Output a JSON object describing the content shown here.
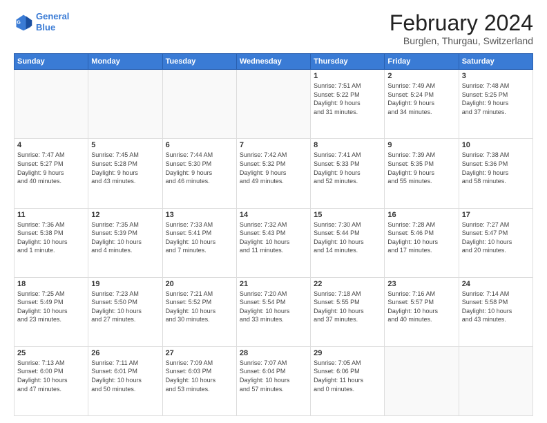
{
  "logo": {
    "line1": "General",
    "line2": "Blue"
  },
  "title": "February 2024",
  "subtitle": "Burglen, Thurgau, Switzerland",
  "days_of_week": [
    "Sunday",
    "Monday",
    "Tuesday",
    "Wednesday",
    "Thursday",
    "Friday",
    "Saturday"
  ],
  "weeks": [
    [
      {
        "day": "",
        "info": ""
      },
      {
        "day": "",
        "info": ""
      },
      {
        "day": "",
        "info": ""
      },
      {
        "day": "",
        "info": ""
      },
      {
        "day": "1",
        "info": "Sunrise: 7:51 AM\nSunset: 5:22 PM\nDaylight: 9 hours\nand 31 minutes."
      },
      {
        "day": "2",
        "info": "Sunrise: 7:49 AM\nSunset: 5:24 PM\nDaylight: 9 hours\nand 34 minutes."
      },
      {
        "day": "3",
        "info": "Sunrise: 7:48 AM\nSunset: 5:25 PM\nDaylight: 9 hours\nand 37 minutes."
      }
    ],
    [
      {
        "day": "4",
        "info": "Sunrise: 7:47 AM\nSunset: 5:27 PM\nDaylight: 9 hours\nand 40 minutes."
      },
      {
        "day": "5",
        "info": "Sunrise: 7:45 AM\nSunset: 5:28 PM\nDaylight: 9 hours\nand 43 minutes."
      },
      {
        "day": "6",
        "info": "Sunrise: 7:44 AM\nSunset: 5:30 PM\nDaylight: 9 hours\nand 46 minutes."
      },
      {
        "day": "7",
        "info": "Sunrise: 7:42 AM\nSunset: 5:32 PM\nDaylight: 9 hours\nand 49 minutes."
      },
      {
        "day": "8",
        "info": "Sunrise: 7:41 AM\nSunset: 5:33 PM\nDaylight: 9 hours\nand 52 minutes."
      },
      {
        "day": "9",
        "info": "Sunrise: 7:39 AM\nSunset: 5:35 PM\nDaylight: 9 hours\nand 55 minutes."
      },
      {
        "day": "10",
        "info": "Sunrise: 7:38 AM\nSunset: 5:36 PM\nDaylight: 9 hours\nand 58 minutes."
      }
    ],
    [
      {
        "day": "11",
        "info": "Sunrise: 7:36 AM\nSunset: 5:38 PM\nDaylight: 10 hours\nand 1 minute."
      },
      {
        "day": "12",
        "info": "Sunrise: 7:35 AM\nSunset: 5:39 PM\nDaylight: 10 hours\nand 4 minutes."
      },
      {
        "day": "13",
        "info": "Sunrise: 7:33 AM\nSunset: 5:41 PM\nDaylight: 10 hours\nand 7 minutes."
      },
      {
        "day": "14",
        "info": "Sunrise: 7:32 AM\nSunset: 5:43 PM\nDaylight: 10 hours\nand 11 minutes."
      },
      {
        "day": "15",
        "info": "Sunrise: 7:30 AM\nSunset: 5:44 PM\nDaylight: 10 hours\nand 14 minutes."
      },
      {
        "day": "16",
        "info": "Sunrise: 7:28 AM\nSunset: 5:46 PM\nDaylight: 10 hours\nand 17 minutes."
      },
      {
        "day": "17",
        "info": "Sunrise: 7:27 AM\nSunset: 5:47 PM\nDaylight: 10 hours\nand 20 minutes."
      }
    ],
    [
      {
        "day": "18",
        "info": "Sunrise: 7:25 AM\nSunset: 5:49 PM\nDaylight: 10 hours\nand 23 minutes."
      },
      {
        "day": "19",
        "info": "Sunrise: 7:23 AM\nSunset: 5:50 PM\nDaylight: 10 hours\nand 27 minutes."
      },
      {
        "day": "20",
        "info": "Sunrise: 7:21 AM\nSunset: 5:52 PM\nDaylight: 10 hours\nand 30 minutes."
      },
      {
        "day": "21",
        "info": "Sunrise: 7:20 AM\nSunset: 5:54 PM\nDaylight: 10 hours\nand 33 minutes."
      },
      {
        "day": "22",
        "info": "Sunrise: 7:18 AM\nSunset: 5:55 PM\nDaylight: 10 hours\nand 37 minutes."
      },
      {
        "day": "23",
        "info": "Sunrise: 7:16 AM\nSunset: 5:57 PM\nDaylight: 10 hours\nand 40 minutes."
      },
      {
        "day": "24",
        "info": "Sunrise: 7:14 AM\nSunset: 5:58 PM\nDaylight: 10 hours\nand 43 minutes."
      }
    ],
    [
      {
        "day": "25",
        "info": "Sunrise: 7:13 AM\nSunset: 6:00 PM\nDaylight: 10 hours\nand 47 minutes."
      },
      {
        "day": "26",
        "info": "Sunrise: 7:11 AM\nSunset: 6:01 PM\nDaylight: 10 hours\nand 50 minutes."
      },
      {
        "day": "27",
        "info": "Sunrise: 7:09 AM\nSunset: 6:03 PM\nDaylight: 10 hours\nand 53 minutes."
      },
      {
        "day": "28",
        "info": "Sunrise: 7:07 AM\nSunset: 6:04 PM\nDaylight: 10 hours\nand 57 minutes."
      },
      {
        "day": "29",
        "info": "Sunrise: 7:05 AM\nSunset: 6:06 PM\nDaylight: 11 hours\nand 0 minutes."
      },
      {
        "day": "",
        "info": ""
      },
      {
        "day": "",
        "info": ""
      }
    ]
  ]
}
